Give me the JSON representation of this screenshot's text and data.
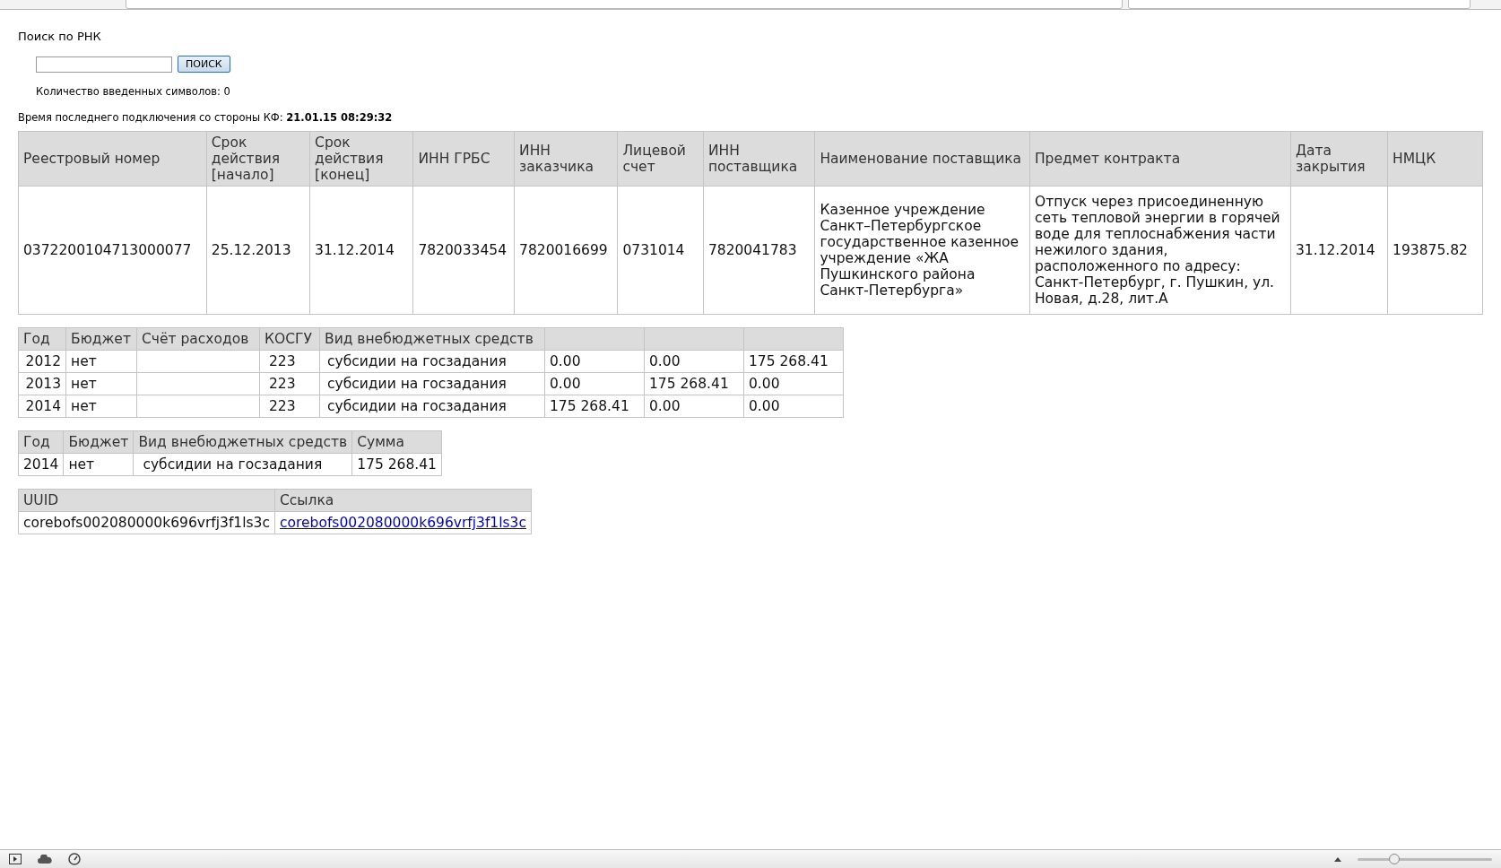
{
  "search": {
    "title": "Поиск по РНК",
    "button": "ПОИСК",
    "counter": "Количество введенных символов: 0"
  },
  "last_connection": "Время последнего подключения со стороны КФ: **21.01.15 08:29:32**",
  "contract_table": {
    "columns": [
      {
        "label": "Реестровый номер"
      },
      {
        "label": "Срок действия [начало]"
      },
      {
        "label": "Срок действия [конец]"
      },
      {
        "label": "ИНН ГРБС"
      },
      {
        "label": "ИНН заказчика"
      },
      {
        "label": "Лицевой счет"
      },
      {
        "label": "ИНН поставщика"
      },
      {
        "label": "Наименование поставщика"
      },
      {
        "label": "Предмет контракта"
      },
      {
        "label": "Дата закрытия"
      },
      {
        "label": "НМЦК"
      }
    ],
    "rows": [
      [
        "0372200104713000077",
        "25.12.2013",
        "31.12.2014",
        "7820033454",
        "7820016699",
        "0731014",
        "7820041783",
        "Казенное учреждение Санкт–Петербургское государственное казенное учреждение «ЖА Пушкинского района Санкт-Петербурга»",
        "Отпуск через присоединенную сеть тепловой энергии в горячей воде для теплоснабжения части нежилого здания, расположенного по адресу: Санкт-Петербург, г. Пушкин, ул. Новая, д.28, лит.А",
        "31.12.2014",
        "193875.82"
      ]
    ]
  },
  "finance_table": {
    "columns": [
      {
        "label": "Год"
      },
      {
        "label": "Бюджет"
      },
      {
        "label": "Счёт расходов"
      },
      {
        "label": "КОСГУ"
      },
      {
        "label": "Вид внебюджетных средств"
      },
      {},
      {},
      {}
    ],
    "rows": [
      [
        "2012",
        "нет",
        null,
        "223",
        "субсидии на госзадания",
        "0.00",
        "0.00",
        "175 268.41"
      ],
      [
        "2013",
        "нет",
        null,
        "223",
        "субсидии на госзадания",
        "0.00",
        "175 268.41",
        "0.00"
      ],
      [
        "2014",
        "нет",
        null,
        "223",
        "субсидии на госзадания",
        "175 268.41",
        "0.00",
        "0.00"
      ]
    ]
  },
  "sum_table": {
    "columns": [
      {
        "label": "Год"
      },
      {
        "label": "Бюджет"
      },
      {
        "label": "Вид внебюджетных средств"
      },
      {
        "label": "Сумма"
      }
    ],
    "rows": [
      [
        "2014",
        "нет",
        "субсидии на госзадания",
        "175 268.41"
      ]
    ]
  },
  "uuid_table": {
    "columns": [
      {
        "label": "UUID",
        "kind": "text"
      },
      {
        "label": "Ссылка",
        "kind": "link"
      }
    ],
    "rows": [
      [
        "corebofs002080000k696vrfj3f1ls3c",
        "corebofs002080000k696vrfj3f1ls3c"
      ]
    ]
  },
  "status_bar": {
    "zoom": {
      "level": 0.27
    }
  }
}
